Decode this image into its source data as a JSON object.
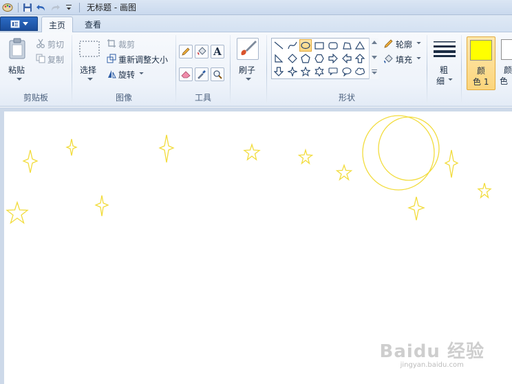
{
  "window": {
    "title": "无标题 - 画图"
  },
  "tabs": [
    {
      "label": "主页",
      "active": true
    },
    {
      "label": "查看",
      "active": false
    }
  ],
  "ribbon": {
    "clipboard": {
      "group_label": "剪贴板",
      "paste": "粘贴",
      "cut": "剪切",
      "copy": "复制"
    },
    "image": {
      "group_label": "图像",
      "select": "选择",
      "crop": "裁剪",
      "resize": "重新调整大小",
      "rotate": "旋转"
    },
    "tools": {
      "group_label": "工具"
    },
    "brushes": {
      "label": "刷子"
    },
    "shapes": {
      "group_label": "形状",
      "outline": "轮廓",
      "fill": "填充"
    },
    "size": {
      "label_line1": "粗",
      "label_line2": "细"
    },
    "colors": {
      "color1_line1": "颜",
      "color1_line2": "色 1",
      "color2_line1": "颜",
      "color2_line2": "色"
    }
  },
  "colors": {
    "accent": "#1a4d9b",
    "color1": "#ffff00",
    "stroke": "#f2dc3c"
  },
  "canvas": {
    "drawing": "stars-and-moon",
    "shapes": [
      {
        "type": "star4",
        "name": "star-4pt"
      },
      {
        "type": "star5",
        "name": "star-5pt"
      },
      {
        "type": "ellipse",
        "name": "moon-circle"
      }
    ]
  },
  "watermark": {
    "logo": "Baidu 经验",
    "url": "jingyan.baidu.com"
  }
}
